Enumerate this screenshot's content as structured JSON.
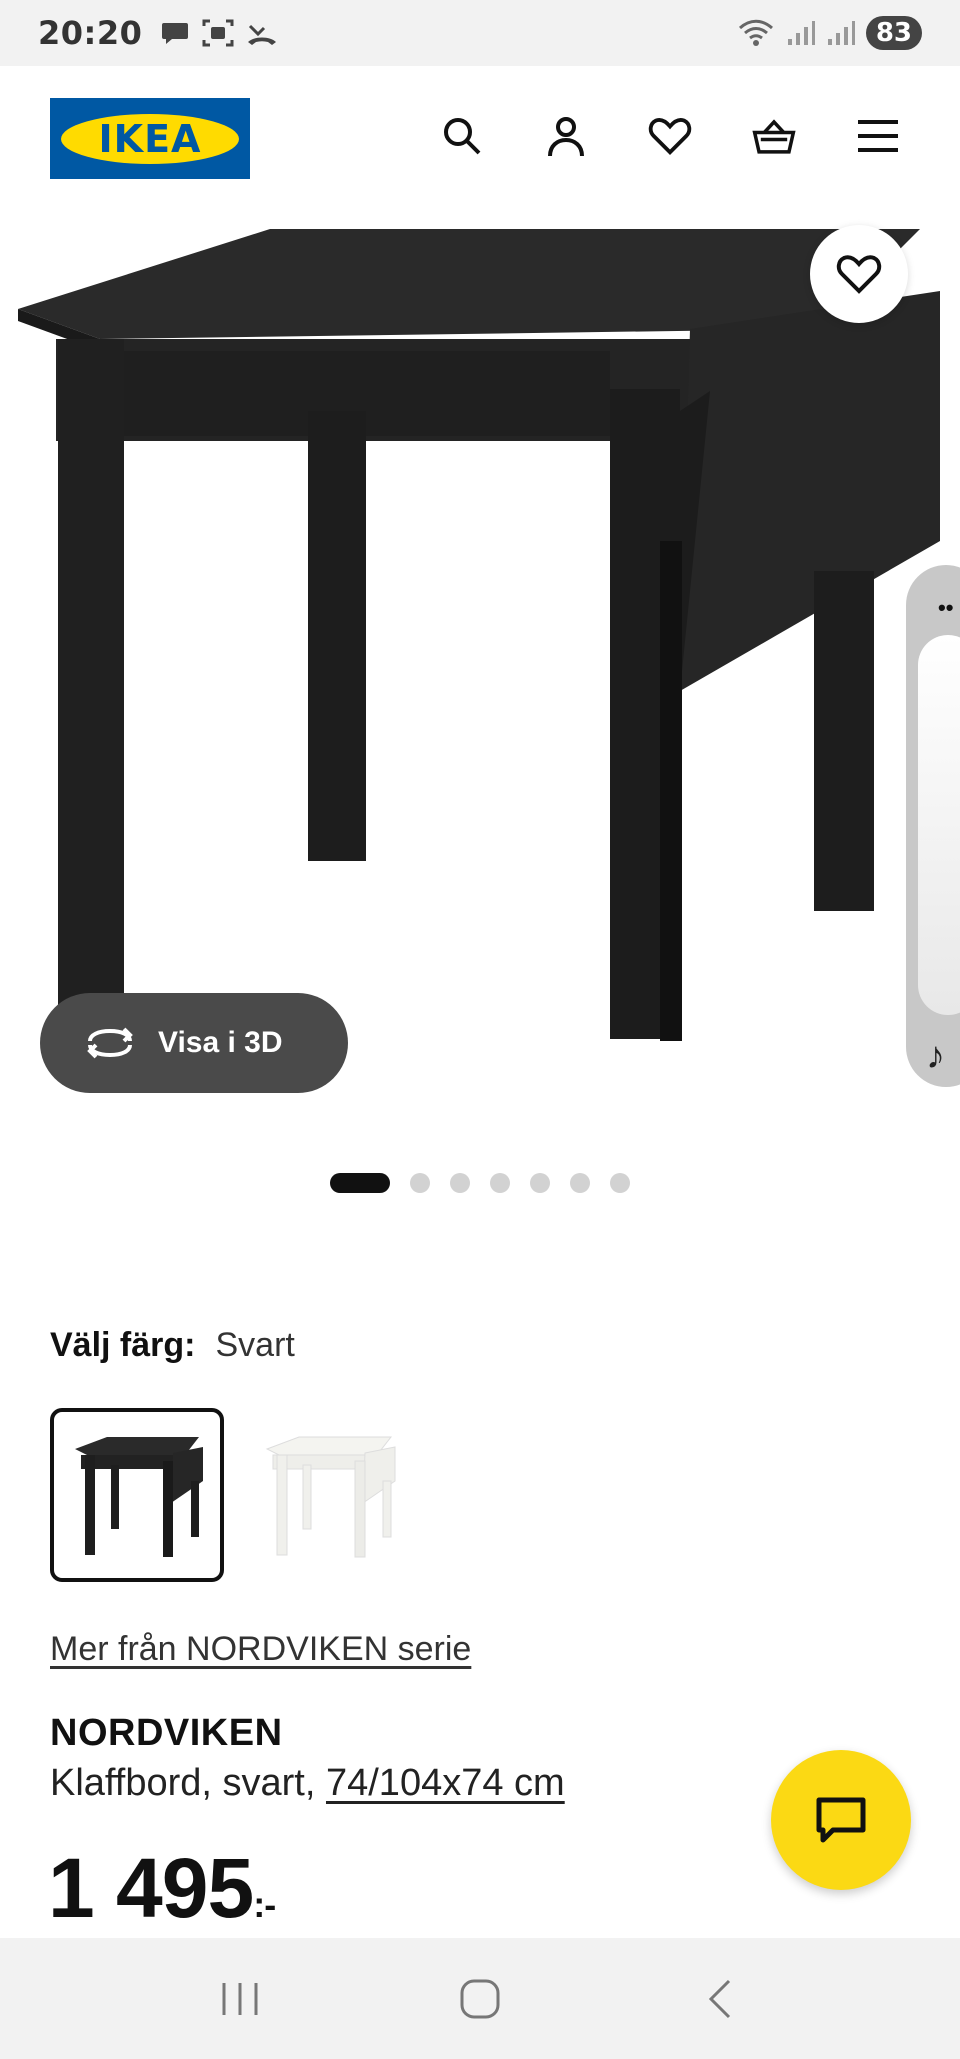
{
  "status_bar": {
    "time": "20:20",
    "battery": "83"
  },
  "header": {
    "logo_text": "IKEA"
  },
  "product_image": {
    "view_3d_label": "Visa i 3D",
    "active_slide": 1,
    "slide_count": 7
  },
  "color": {
    "label": "Välj färg:",
    "value": "Svart",
    "options": [
      "Svart",
      "Vit"
    ]
  },
  "series_link": "Mer från NORDVIKEN serie",
  "product": {
    "name": "NORDVIKEN",
    "description": "Klaffbord, svart, ",
    "dimensions": "74/104x74 cm",
    "price": "1 495",
    "price_suffix": ":-"
  },
  "colors": {
    "ikea_blue": "#0058a3",
    "ikea_yellow": "#ffdb00",
    "chat_yellow": "#fbd914"
  }
}
